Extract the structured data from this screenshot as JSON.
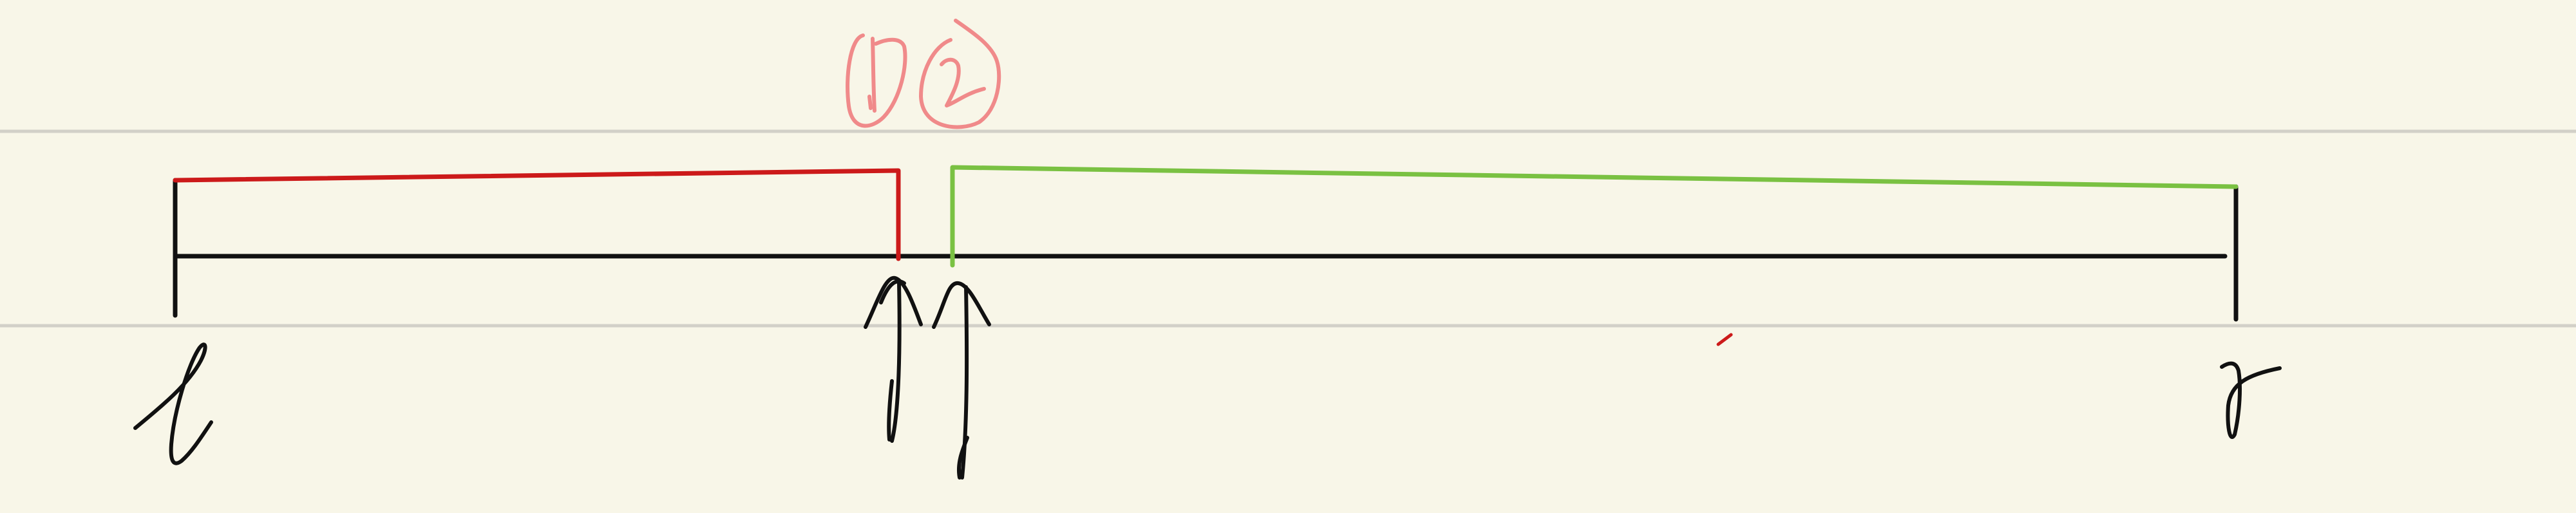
{
  "colors": {
    "background": "#f8f6e8",
    "rule_line": "#d2d0c8",
    "ink": "#111111",
    "first_segment": "#cc1a1a",
    "second_segment": "#7ac142",
    "annotation": "#f08a8a"
  },
  "labels": {
    "left_end": "l",
    "right_end": "r",
    "annotation_1": "①",
    "annotation_2": "②"
  }
}
